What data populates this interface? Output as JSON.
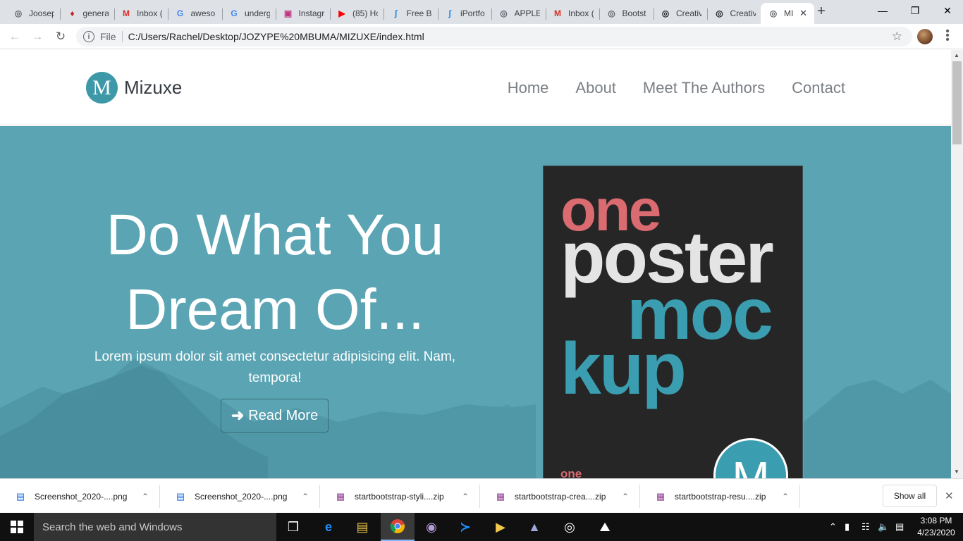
{
  "browser": {
    "tabs": [
      {
        "label": "Joosep",
        "icon": "globe-icon",
        "color": "#5f6368"
      },
      {
        "label": "genera",
        "icon": "book-icon",
        "color": "#c5221f"
      },
      {
        "label": "Inbox (",
        "icon": "gmail-icon",
        "color": "#d93025"
      },
      {
        "label": "aweso",
        "icon": "google-icon",
        "color": "#4285f4"
      },
      {
        "label": "underg",
        "icon": "google-icon",
        "color": "#4285f4"
      },
      {
        "label": "Instagr",
        "icon": "instagram-icon",
        "color": "#c13584"
      },
      {
        "label": "(85) Ho",
        "icon": "youtube-icon",
        "color": "#ff0000"
      },
      {
        "label": "Free Bo",
        "icon": "bootstrap-bird-icon",
        "color": "#1e88e5"
      },
      {
        "label": "iPortfo",
        "icon": "bootstrap-bird-icon",
        "color": "#1e88e5"
      },
      {
        "label": "APPLE",
        "icon": "globe-icon",
        "color": "#5f6368"
      },
      {
        "label": "Inbox (",
        "icon": "gmail-icon",
        "color": "#d93025"
      },
      {
        "label": "Bootst",
        "icon": "globe-icon",
        "color": "#5f6368"
      },
      {
        "label": "Creativ",
        "icon": "globe-icon",
        "color": "#202124"
      },
      {
        "label": "Creativ",
        "icon": "globe-icon",
        "color": "#202124"
      },
      {
        "label": "MI",
        "icon": "globe-icon",
        "color": "#5f6368",
        "active": true
      }
    ],
    "address": {
      "scheme_label": "File",
      "url": "C:/Users/Rachel/Desktop/JOZYPE%20MBUMA/MIZUXE/index.html"
    }
  },
  "site": {
    "brand_initial": "M",
    "brand_name": "Mizuxe",
    "nav": [
      "Home",
      "About",
      "Meet The Authors",
      "Contact"
    ],
    "hero": {
      "title_line1": "Do What You",
      "title_line2": "Dream Of...",
      "subtitle": "Lorem ipsum dolor sit amet consectetur adipisicing elit. Nam, tempora!",
      "button_label": "Read More"
    },
    "poster": {
      "word1": "one",
      "word2": "poster",
      "word3": "moc",
      "word4": "kup",
      "small_word": "one",
      "logo_letter": "M"
    },
    "colors": {
      "accent": "#3d98a8",
      "hero_bg": "#5aa4b3",
      "poster_bg": "#262626",
      "poster_red": "#d96b71",
      "poster_teal": "#3a9db0"
    }
  },
  "downloads": {
    "items": [
      {
        "name": "Screenshot_2020-....png",
        "icon": "image-file-icon"
      },
      {
        "name": "Screenshot_2020-....png",
        "icon": "image-file-icon"
      },
      {
        "name": "startbootstrap-styli....zip",
        "icon": "winrar-archive-icon"
      },
      {
        "name": "startbootstrap-crea....zip",
        "icon": "winrar-archive-icon"
      },
      {
        "name": "startbootstrap-resu....zip",
        "icon": "winrar-archive-icon"
      }
    ],
    "show_all": "Show all"
  },
  "taskbar": {
    "search_placeholder": "Search the web and Windows",
    "time": "3:08 PM",
    "date": "4/23/2020"
  }
}
